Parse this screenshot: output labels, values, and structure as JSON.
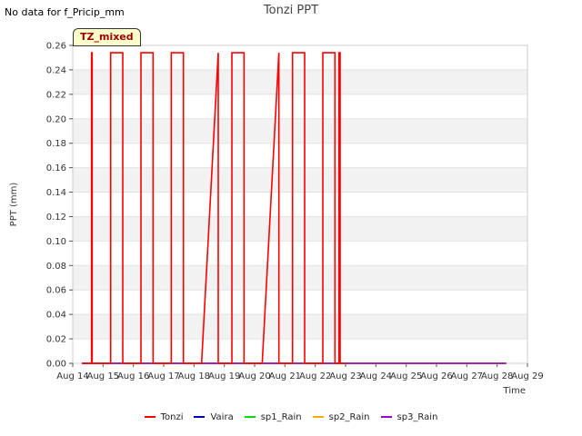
{
  "header": {
    "nodata_text": "No data for f_Pricip_mm",
    "title": "Tonzi PPT",
    "badge": "TZ_mixed"
  },
  "colors": {
    "Tonzi": "#ff0000",
    "Vaira": "#0000bb",
    "sp1_Rain": "#00dd00",
    "sp2_Rain": "#ffaa00",
    "sp3_Rain": "#9900cc"
  },
  "chart_data": {
    "type": "line",
    "title": "Tonzi PPT",
    "xlabel": "Time",
    "ylabel": "PPT (mm)",
    "xlim": [
      14,
      29
    ],
    "ylim": [
      0,
      0.26
    ],
    "grid": "horizontal-bands",
    "legend_position": "bottom",
    "xticks": [
      {
        "v": 14,
        "label": "Aug 14"
      },
      {
        "v": 15,
        "label": "Aug 15"
      },
      {
        "v": 16,
        "label": "Aug 16"
      },
      {
        "v": 17,
        "label": "Aug 17"
      },
      {
        "v": 18,
        "label": "Aug 18"
      },
      {
        "v": 19,
        "label": "Aug 19"
      },
      {
        "v": 20,
        "label": "Aug 20"
      },
      {
        "v": 21,
        "label": "Aug 21"
      },
      {
        "v": 22,
        "label": "Aug 22"
      },
      {
        "v": 23,
        "label": "Aug 23"
      },
      {
        "v": 24,
        "label": "Aug 24"
      },
      {
        "v": 25,
        "label": "Aug 25"
      },
      {
        "v": 26,
        "label": "Aug 26"
      },
      {
        "v": 27,
        "label": "Aug 27"
      },
      {
        "v": 28,
        "label": "Aug 28"
      },
      {
        "v": 29,
        "label": "Aug 29"
      }
    ],
    "yticks": [
      0.0,
      0.02,
      0.04,
      0.06,
      0.08,
      0.1,
      0.12,
      0.14,
      0.16,
      0.18,
      0.2,
      0.22,
      0.24,
      0.26
    ],
    "series": [
      {
        "name": "Tonzi",
        "x": [
          14.3,
          14.62,
          14.62,
          14.64,
          14.64,
          15.25,
          15.25,
          15.65,
          15.65,
          16.25,
          16.25,
          16.65,
          16.65,
          17.25,
          17.25,
          17.65,
          17.65,
          18.25,
          18.8,
          18.8,
          19.25,
          19.25,
          19.65,
          19.65,
          20.25,
          20.8,
          20.8,
          21.25,
          21.25,
          21.65,
          21.65,
          22.25,
          22.25,
          22.65,
          22.65,
          22.78,
          22.78,
          22.82,
          22.82,
          23.0
        ],
        "y": [
          0,
          0,
          0.254,
          0.254,
          0,
          0,
          0.254,
          0.254,
          0,
          0,
          0.254,
          0.254,
          0,
          0,
          0.254,
          0.254,
          0,
          0,
          0.254,
          0,
          0,
          0.254,
          0.254,
          0,
          0,
          0.254,
          0,
          0,
          0.254,
          0.254,
          0,
          0,
          0.254,
          0.254,
          0,
          0,
          0.254,
          0.254,
          0,
          0
        ]
      },
      {
        "name": "Vaira",
        "x": [
          14.3,
          28.3
        ],
        "y": [
          0,
          0
        ]
      },
      {
        "name": "sp1_Rain",
        "x": [
          14.3,
          28.3
        ],
        "y": [
          0,
          0
        ]
      },
      {
        "name": "sp2_Rain",
        "x": [
          14.3,
          28.3
        ],
        "y": [
          0,
          0
        ]
      },
      {
        "name": "sp3_Rain",
        "x": [
          14.3,
          28.3
        ],
        "y": [
          0,
          0
        ]
      }
    ]
  }
}
